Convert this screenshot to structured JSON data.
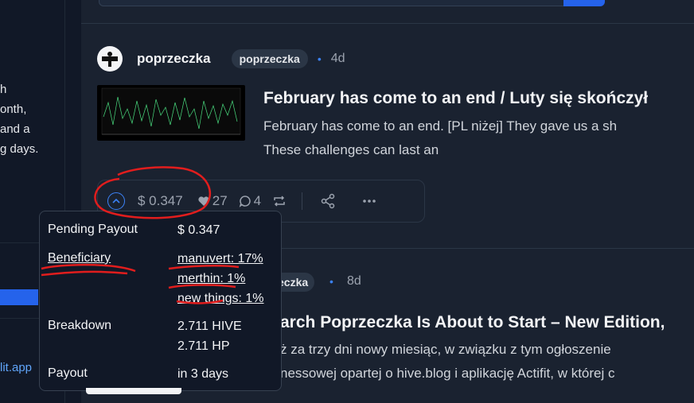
{
  "left_panel": {
    "lines": [
      "h",
      "onth,",
      " and a",
      "g days."
    ],
    "link": "lit.app"
  },
  "post1": {
    "author": "poprzeczka",
    "tag": "poprzeczka",
    "age": "4d",
    "title": "February has come to an end / Luty się skończył",
    "excerpt_lines": [
      "February has come to an end. [PL niżej] They gave us a sh",
      "These challenges can last an"
    ],
    "payout": "$ 0.347",
    "likes": "27",
    "comments": "4"
  },
  "tooltip": {
    "rows": [
      {
        "label": "Pending Payout",
        "values": [
          "$ 0.347"
        ]
      },
      {
        "label": "Beneficiary",
        "values": [
          "manuvert: 17%",
          "merthin: 1%",
          "new things: 1%"
        ]
      },
      {
        "label": "Breakdown",
        "values": [
          "2.711 HIVE",
          "2.711 HP"
        ]
      },
      {
        "label": "Payout",
        "values": [
          "in 3 days"
        ]
      }
    ]
  },
  "post2": {
    "tag": "zeczka",
    "age": "8d",
    "title": "arch Poprzeczka Is About to Start – New Edition,",
    "excerpt_lines": [
      "ż za trzy dni nowy miesiąc, w związku z tym ogłoszenie",
      "nessowej opartej o hive.blog i aplikację Actifit, w której c"
    ]
  },
  "colors": {
    "accent": "#3b82f6",
    "annotation": "#e11d1d",
    "background": "#1a2230"
  }
}
